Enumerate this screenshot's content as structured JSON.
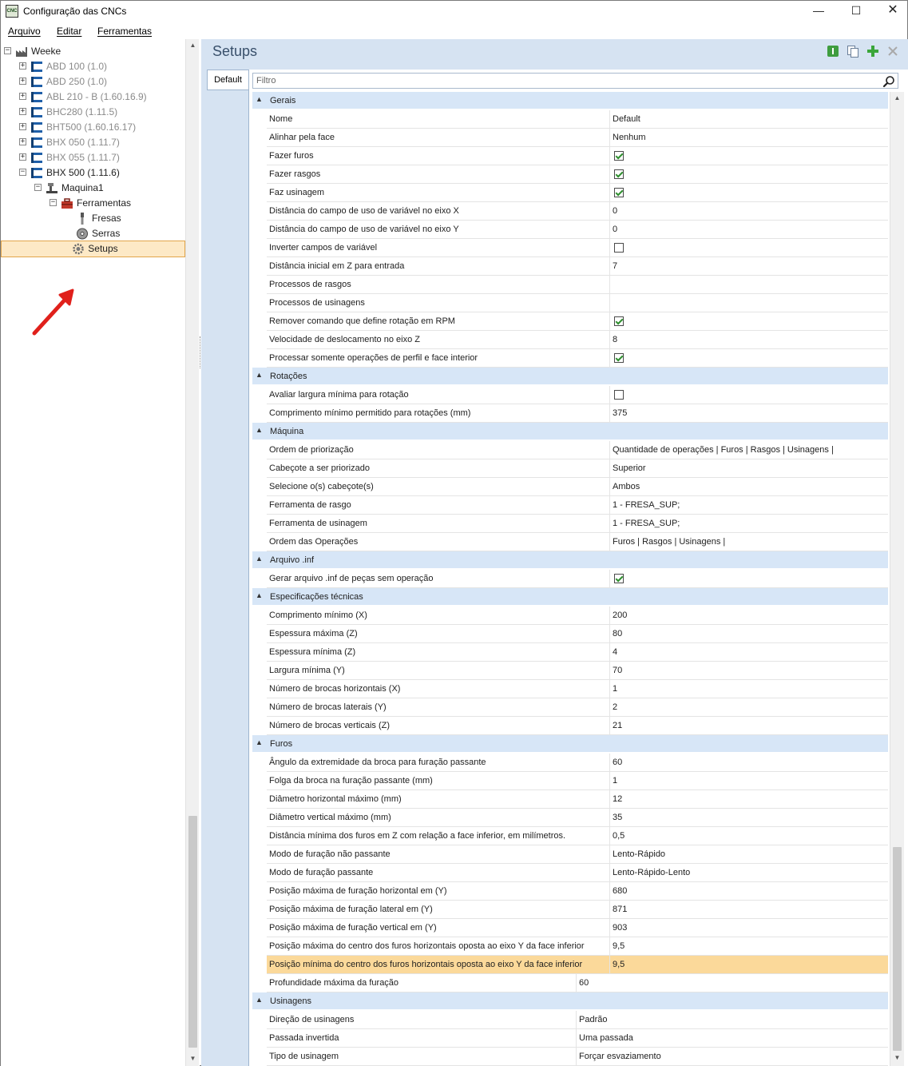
{
  "window": {
    "title": "Configuração das CNCs",
    "app_icon_text": "CNC",
    "controls": [
      "minimize-icon",
      "maximize-icon",
      "close-icon"
    ]
  },
  "menu": [
    "Arquivo",
    "Editar",
    "Ferramentas"
  ],
  "tree": {
    "root": "Weeke",
    "machines": [
      {
        "label": "ABD 100 (1.0)",
        "disabled": true
      },
      {
        "label": "ABD 250 (1.0)",
        "disabled": true
      },
      {
        "label": "ABL 210 - B (1.60.16.9)",
        "disabled": true
      },
      {
        "label": "BHC280 (1.11.5)",
        "disabled": true
      },
      {
        "label": "BHT500 (1.60.16.17)",
        "disabled": true
      },
      {
        "label": "BHX 050 (1.11.7)",
        "disabled": true
      },
      {
        "label": "BHX 055 (1.11.7)",
        "disabled": true
      },
      {
        "label": "BHX 500 (1.11.6)",
        "disabled": false
      }
    ],
    "machine_node": "Maquina1",
    "tools_node": "Ferramentas",
    "tool_items": [
      "Fresas",
      "Serras"
    ],
    "setups_node": "Setups"
  },
  "panel": {
    "title": "Setups",
    "tab": "Default",
    "filter_placeholder": "Filtro",
    "toolbar_icons": [
      "green-info-icon",
      "copy-icon",
      "add-icon",
      "delete-icon"
    ]
  },
  "categories": [
    {
      "label": "Gerais",
      "rows": [
        {
          "name": "Nome",
          "value": "Default"
        },
        {
          "name": "Alinhar pela face",
          "value": "Nenhum"
        },
        {
          "name": "Fazer furos",
          "check": true
        },
        {
          "name": "Fazer rasgos",
          "check": true
        },
        {
          "name": "Faz usinagem",
          "check": true
        },
        {
          "name": "Distância do campo de uso de variável no eixo X",
          "value": "0"
        },
        {
          "name": "Distância do campo de uso de variável no eixo Y",
          "value": "0"
        },
        {
          "name": "Inverter campos de variável",
          "check": false
        },
        {
          "name": "Distância inicial em Z para entrada",
          "value": "7"
        },
        {
          "name": "Processos de rasgos",
          "value": ""
        },
        {
          "name": "Processos de usinagens",
          "value": ""
        },
        {
          "name": "Remover comando que define rotação em RPM",
          "check": true
        },
        {
          "name": "Velocidade de deslocamento no eixo Z",
          "value": "8"
        },
        {
          "name": "Processar somente operações de perfil e face interior",
          "check": true
        }
      ]
    },
    {
      "label": "Rotações",
      "rows": [
        {
          "name": "Avaliar largura mínima para rotação",
          "check": false
        },
        {
          "name": "Comprimento mínimo permitido para rotações (mm)",
          "value": "375"
        }
      ]
    },
    {
      "label": "Máquina",
      "rows": [
        {
          "name": "Ordem de priorização",
          "value": "Quantidade de operações | Furos | Rasgos | Usinagens |"
        },
        {
          "name": "Cabeçote a ser priorizado",
          "value": "Superior"
        },
        {
          "name": "Selecione o(s) cabeçote(s)",
          "value": "Ambos"
        },
        {
          "name": "Ferramenta de rasgo",
          "value": "1 - FRESA_SUP;"
        },
        {
          "name": "Ferramenta de usinagem",
          "value": "1 - FRESA_SUP;"
        },
        {
          "name": "Ordem das Operações",
          "value": "Furos | Rasgos | Usinagens |"
        }
      ]
    },
    {
      "label": "Arquivo .inf",
      "rows": [
        {
          "name": "Gerar arquivo .inf de peças sem operação",
          "check": true
        }
      ]
    },
    {
      "label": "Especificações técnicas",
      "rows": [
        {
          "name": "Comprimento mínimo (X)",
          "value": "200"
        },
        {
          "name": "Espessura máxima (Z)",
          "value": "80"
        },
        {
          "name": "Espessura mínima (Z)",
          "value": "4"
        },
        {
          "name": "Largura mínima (Y)",
          "value": "70"
        },
        {
          "name": "Número de brocas horizontais (X)",
          "value": "1"
        },
        {
          "name": "Número de brocas laterais (Y)",
          "value": "2"
        },
        {
          "name": "Número de brocas verticais (Z)",
          "value": "21"
        }
      ]
    },
    {
      "label": "Furos",
      "rows": [
        {
          "name": "Ângulo da extremidade da broca para furação passante",
          "value": "60"
        },
        {
          "name": "Folga da broca na furação passante (mm)",
          "value": "1"
        },
        {
          "name": "Diâmetro horizontal máximo (mm)",
          "value": "12"
        },
        {
          "name": "Diâmetro vertical máximo (mm)",
          "value": "35"
        },
        {
          "name": "Distância mínima dos furos em Z com relação a face inferior, em milímetros.",
          "value": "0,5"
        },
        {
          "name": "Modo de furação não passante",
          "value": "Lento-Rápido"
        },
        {
          "name": "Modo de furação passante",
          "value": "Lento-Rápido-Lento"
        },
        {
          "name": "Posição máxima de furação horizontal em (Y)",
          "value": "680"
        },
        {
          "name": "Posição máxima de furação lateral em (Y)",
          "value": "871"
        },
        {
          "name": "Posição máxima de furação vertical em (Y)",
          "value": "903"
        },
        {
          "name": "Posição máxima do centro dos furos horizontais oposta ao eixo Y da face inferior",
          "value": "9,5"
        },
        {
          "name": "Posição mínima do centro dos furos horizontais oposta ao eixo Y da face inferior",
          "value": "9,5",
          "highlight": true
        },
        {
          "name": "Profundidade máxima da furação",
          "value": "60",
          "narrow": true
        }
      ]
    },
    {
      "label": "Usinagens",
      "rows": [
        {
          "name": "Direção de usinagens",
          "value": "Padrão",
          "narrow": true
        },
        {
          "name": "Passada invertida",
          "value": "Uma passada",
          "narrow": true
        },
        {
          "name": "Tipo de usinagem",
          "value": "Forçar esvaziamento",
          "narrow": true
        }
      ]
    }
  ],
  "colors": {
    "accent": "#d6e3f2",
    "category_bg": "#d7e6f7",
    "highlight_row": "#fbd99a",
    "annotation_arrow": "#e0201b"
  }
}
